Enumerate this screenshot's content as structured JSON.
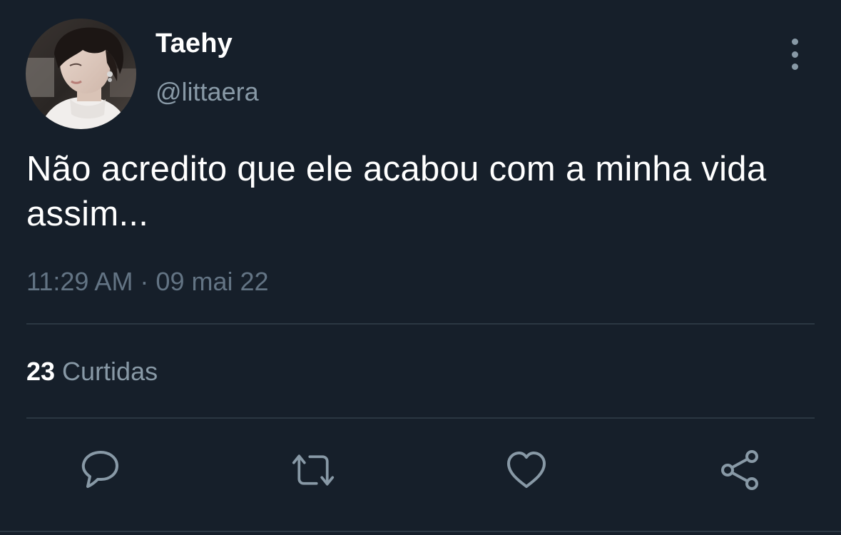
{
  "author": {
    "display_name": "Taehy",
    "handle": "@littaera"
  },
  "tweet": {
    "text": "Não acredito que ele acabou com a minha vida assim...",
    "timestamp": "11:29 AM · 09 mai 22"
  },
  "stats": {
    "likes_count": "23",
    "likes_label": "Curtidas"
  },
  "icons": {
    "more": "more-vertical-icon",
    "reply": "reply-icon",
    "retweet": "retweet-icon",
    "like": "heart-icon",
    "share": "share-icon"
  },
  "colors": {
    "background": "#161f2a",
    "primary_text": "#ffffff",
    "secondary_text": "#8899a6",
    "divider": "#2b3742",
    "icon": "#8899a6"
  }
}
